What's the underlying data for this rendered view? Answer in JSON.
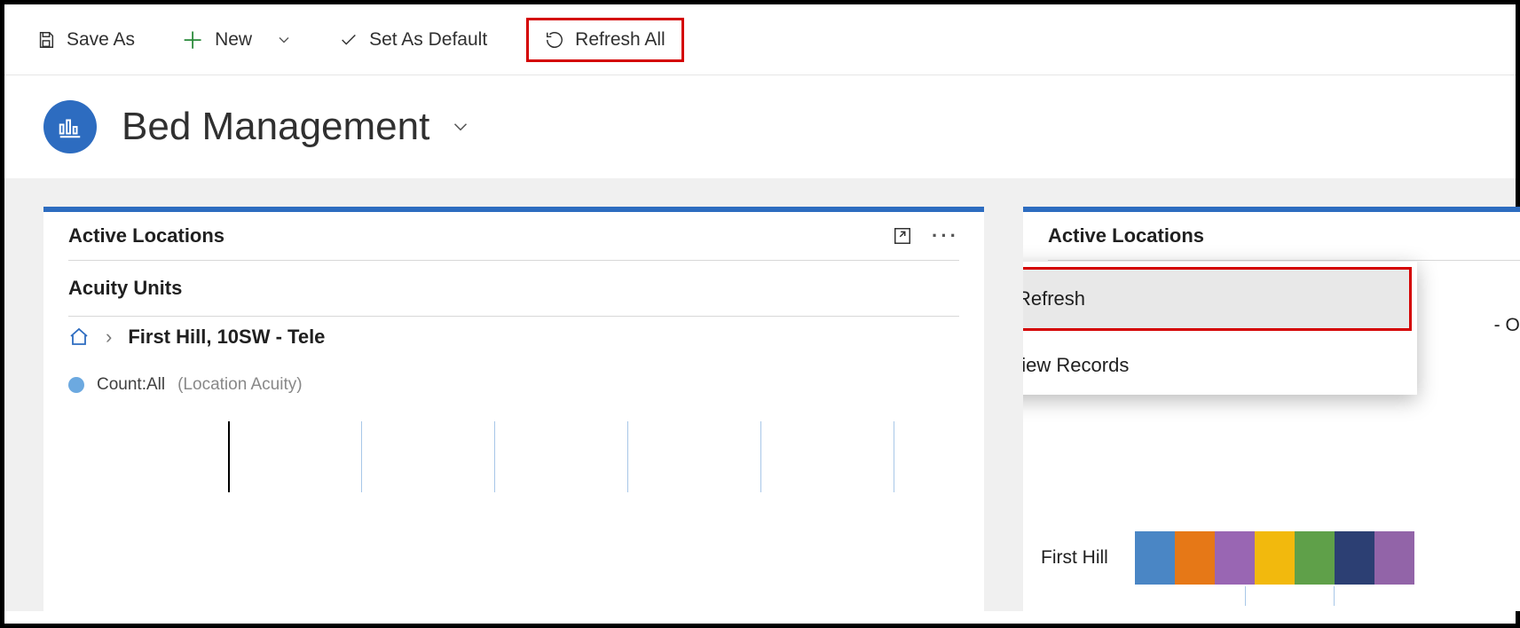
{
  "toolbar": {
    "save_as": "Save As",
    "new": "New",
    "set_default": "Set As Default",
    "refresh_all": "Refresh All"
  },
  "header": {
    "title": "Bed Management"
  },
  "panel_left": {
    "title": "Active Locations",
    "subtitle": "Acuity Units",
    "breadcrumb": "First Hill, 10SW - Tele",
    "legend_main": "Count:All",
    "legend_sub": "(Location Acuity)"
  },
  "panel_right": {
    "title": "Active Locations",
    "breadcrumb_suffix": "- Obs",
    "row_label": "First Hill",
    "bar_colors": [
      "#4a86c5",
      "#e67817",
      "#9966b3",
      "#f2b90d",
      "#5fa049",
      "#2c3f73",
      "#9264a8"
    ]
  },
  "context_menu": {
    "refresh": "Refresh",
    "view_records": "View Records"
  }
}
